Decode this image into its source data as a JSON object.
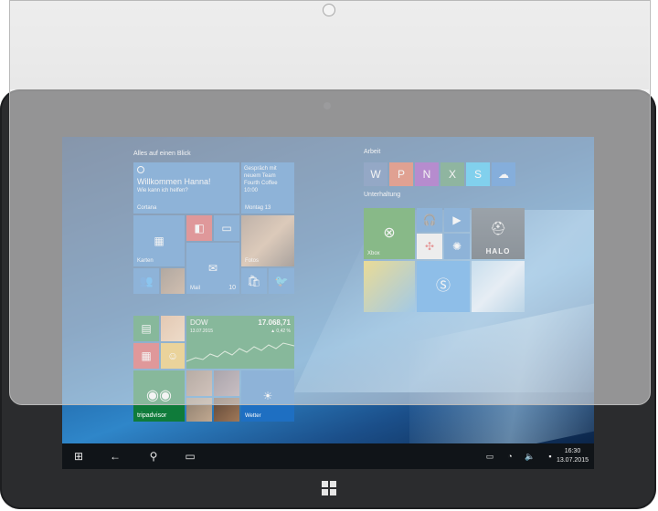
{
  "start": {
    "groups": {
      "main": "Alles auf einen Blick",
      "work": "Arbeit",
      "fun": "Unterhaltung"
    },
    "tiles": {
      "cortana": {
        "greeting": "Willkommen Hanna!",
        "sub": "Wie kann ich helfen?",
        "label": "Cortana"
      },
      "calendar": {
        "line1": "Gespräch mit",
        "line2": "neuem Team",
        "line3": "Fourth Coffee",
        "line4": "10:00",
        "label": "Montag 13"
      },
      "maps": {
        "label": "Karten"
      },
      "photos": {
        "label": "Fotos"
      },
      "mail": {
        "label": "Mail",
        "count": "10"
      },
      "money": {
        "title": "DOW",
        "value": "17.068,71",
        "date": "13.07.2015",
        "change": "▲ 0,42 %"
      },
      "tripadvisor": {
        "label": "tripadvisor"
      },
      "weather": {
        "label": "Wetter"
      },
      "xbox": {
        "label": "Xbox"
      }
    },
    "icons": [
      "flipboard-icon",
      "store-icon",
      "twitter-icon",
      "people-icon",
      "camera-icon",
      "music-icon",
      "video-icon",
      "shazam-icon"
    ]
  },
  "taskbar": {
    "time": "16:30",
    "date": "13.07.2015",
    "icons": {
      "start": "⊞",
      "back": "←",
      "search": "⚲",
      "taskview": "▭",
      "battery": "▭",
      "wifi": "◔",
      "volume": "🔈",
      "notify": "▪"
    }
  },
  "colors": {
    "tile_blue": "#1e6fc2",
    "tile_red": "#d13438",
    "tile_green": "#0f7b3a",
    "xbox_green": "#107c10",
    "word": "#2b579a",
    "excel": "#217346",
    "ppt": "#d24726",
    "onenote": "#7719aa",
    "skype": "#00aff0",
    "onedrive": "#0a64c8"
  }
}
